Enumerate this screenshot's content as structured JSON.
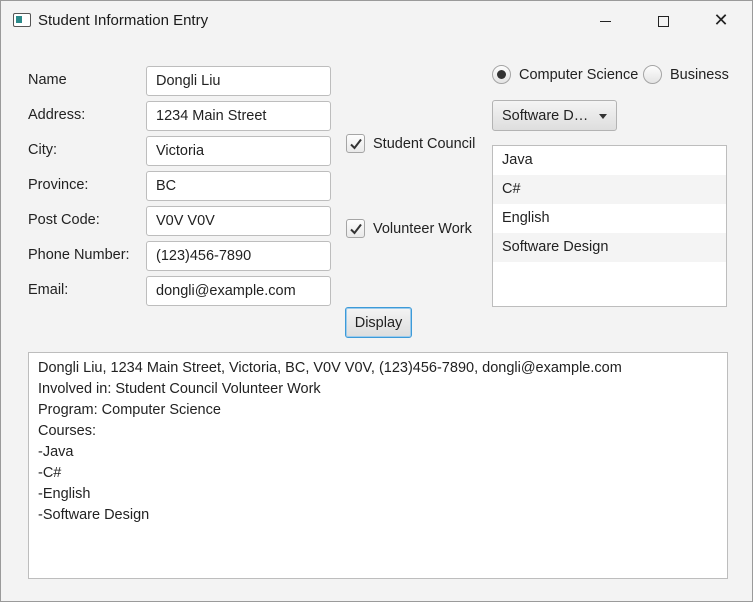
{
  "window": {
    "title": "Student Information Entry"
  },
  "form": {
    "fields": [
      {
        "label": "Name",
        "value": "Dongli Liu"
      },
      {
        "label": "Address:",
        "value": "1234 Main Street"
      },
      {
        "label": "City:",
        "value": "Victoria"
      },
      {
        "label": "Province:",
        "value": "BC"
      },
      {
        "label": "Post Code:",
        "value": "V0V V0V"
      },
      {
        "label": "Phone Number:",
        "value": "(123)456-7890"
      },
      {
        "label": "Email:",
        "value": "dongli@example.com"
      }
    ]
  },
  "checkboxes": [
    {
      "label": "Student Council",
      "checked": true
    },
    {
      "label": "Volunteer Work",
      "checked": true
    }
  ],
  "program": {
    "options": [
      {
        "label": "Computer Science",
        "selected": true
      },
      {
        "label": "Business",
        "selected": false
      }
    ]
  },
  "course_combo": {
    "selected": "Software Desi..."
  },
  "course_list": {
    "items": [
      "Java",
      "C#",
      "English",
      "Software Design"
    ]
  },
  "display_button": {
    "label": "Display"
  },
  "output": {
    "lines": [
      "Dongli Liu, 1234 Main Street, Victoria, BC, V0V V0V, (123)456-7890, dongli@example.com",
      "Involved in: Student Council Volunteer Work",
      "Program: Computer Science",
      "Courses:",
      "-Java",
      "-C#",
      "-English",
      "-Software Design"
    ]
  }
}
